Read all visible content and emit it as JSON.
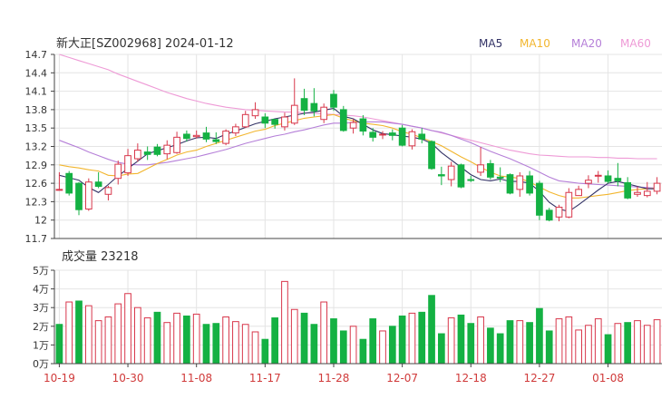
{
  "title": "新大正[SZ002968] 2024-01-12",
  "legend": [
    {
      "label": "MA5",
      "color": "#333366"
    },
    {
      "label": "MA10",
      "color": "#f2b62f"
    },
    {
      "label": "MA20",
      "color": "#b57fd8"
    },
    {
      "label": "MA60",
      "color": "#ee9ad6"
    }
  ],
  "colors": {
    "up": "#d8374b",
    "down": "#14b143",
    "xtick": "#d03a3a",
    "grid": "#e4e4e4",
    "axis": "#444444"
  },
  "volume_label": "成交量 23218",
  "chart_data": [
    {
      "type": "candlestick",
      "title": "新大正[SZ002968] 2024-01-12",
      "ylim": [
        11.7,
        14.7
      ],
      "yticks": [
        "14.7",
        "14.4",
        "14.1",
        "13.8",
        "13.5",
        "13.2",
        "12.9",
        "12.6",
        "12.3",
        "12",
        "11.7"
      ],
      "ytick_values": [
        14.7,
        14.4,
        14.1,
        13.8,
        13.5,
        13.2,
        12.9,
        12.6,
        12.3,
        12.0,
        11.7
      ],
      "xticks": [
        {
          "label": "10-19",
          "index": 0
        },
        {
          "label": "10-30",
          "index": 7
        },
        {
          "label": "11-08",
          "index": 14
        },
        {
          "label": "11-17",
          "index": 21
        },
        {
          "label": "11-28",
          "index": 28
        },
        {
          "label": "12-07",
          "index": 35
        },
        {
          "label": "12-18",
          "index": 42
        },
        {
          "label": "12-27",
          "index": 49
        },
        {
          "label": "01-08",
          "index": 56
        }
      ],
      "candles": [
        [
          12.5,
          12.5,
          12.78,
          12.48
        ],
        [
          12.76,
          12.44,
          12.8,
          12.4
        ],
        [
          12.6,
          12.17,
          12.62,
          12.08
        ],
        [
          12.18,
          12.62,
          12.68,
          12.15
        ],
        [
          12.62,
          12.55,
          12.78,
          12.52
        ],
        [
          12.42,
          12.53,
          12.56,
          12.32
        ],
        [
          12.68,
          12.91,
          12.97,
          12.58
        ],
        [
          12.77,
          13.05,
          13.16,
          12.72
        ],
        [
          13.0,
          13.14,
          13.25,
          12.95
        ],
        [
          13.11,
          13.07,
          13.2,
          12.98
        ],
        [
          13.19,
          13.07,
          13.24,
          13.04
        ],
        [
          13.08,
          13.22,
          13.3,
          12.99
        ],
        [
          13.1,
          13.35,
          13.44,
          13.08
        ],
        [
          13.4,
          13.33,
          13.46,
          13.28
        ],
        [
          13.36,
          13.38,
          13.46,
          13.33
        ],
        [
          13.42,
          13.32,
          13.52,
          13.27
        ],
        [
          13.31,
          13.28,
          13.43,
          13.24
        ],
        [
          13.25,
          13.45,
          13.48,
          13.22
        ],
        [
          13.42,
          13.52,
          13.57,
          13.37
        ],
        [
          13.52,
          13.72,
          13.78,
          13.5
        ],
        [
          13.7,
          13.8,
          13.92,
          13.65
        ],
        [
          13.68,
          13.58,
          13.74,
          13.5
        ],
        [
          13.64,
          13.56,
          13.64,
          13.49
        ],
        [
          13.52,
          13.68,
          13.75,
          13.46
        ],
        [
          13.58,
          13.87,
          14.31,
          13.55
        ],
        [
          13.98,
          13.79,
          14.14,
          13.71
        ],
        [
          13.9,
          13.78,
          14.15,
          13.69
        ],
        [
          13.64,
          13.84,
          13.9,
          13.58
        ],
        [
          14.05,
          13.84,
          14.12,
          13.78
        ],
        [
          13.8,
          13.46,
          13.86,
          13.44
        ],
        [
          13.5,
          13.59,
          13.65,
          13.41
        ],
        [
          13.65,
          13.45,
          13.71,
          13.38
        ],
        [
          13.43,
          13.35,
          13.5,
          13.28
        ],
        [
          13.4,
          13.4,
          13.45,
          13.32
        ],
        [
          13.42,
          13.38,
          13.48,
          13.3
        ],
        [
          13.5,
          13.22,
          13.55,
          13.2
        ],
        [
          13.21,
          13.44,
          13.48,
          13.15
        ],
        [
          13.4,
          13.32,
          13.5,
          13.25
        ],
        [
          13.28,
          12.84,
          13.3,
          12.82
        ],
        [
          12.74,
          12.72,
          12.87,
          12.57
        ],
        [
          12.66,
          12.88,
          12.95,
          12.55
        ],
        [
          12.9,
          12.54,
          12.92,
          12.52
        ],
        [
          12.66,
          12.65,
          12.72,
          12.62
        ],
        [
          12.78,
          12.9,
          13.19,
          12.72
        ],
        [
          12.92,
          12.7,
          12.98,
          12.66
        ],
        [
          12.7,
          12.69,
          12.86,
          12.62
        ],
        [
          12.74,
          12.44,
          12.76,
          12.42
        ],
        [
          12.5,
          12.72,
          12.78,
          12.38
        ],
        [
          12.72,
          12.44,
          12.8,
          12.4
        ],
        [
          12.6,
          12.08,
          12.64,
          12.0
        ],
        [
          12.16,
          12.0,
          12.2,
          11.98
        ],
        [
          12.05,
          12.21,
          12.25,
          11.98
        ],
        [
          12.05,
          12.45,
          12.52,
          12.03
        ],
        [
          12.4,
          12.5,
          12.56,
          12.4
        ],
        [
          12.6,
          12.65,
          12.73,
          12.52
        ],
        [
          12.72,
          12.73,
          12.8,
          12.61
        ],
        [
          12.72,
          12.63,
          12.81,
          12.6
        ],
        [
          12.68,
          12.64,
          12.93,
          12.55
        ],
        [
          12.61,
          12.36,
          12.7,
          12.34
        ],
        [
          12.42,
          12.45,
          12.55,
          12.38
        ],
        [
          12.4,
          12.47,
          12.62,
          12.37
        ],
        [
          12.47,
          12.6,
          12.7,
          12.42
        ]
      ],
      "ma5": [
        12.73,
        12.69,
        12.65,
        12.53,
        12.45,
        12.58,
        12.72,
        12.84,
        12.96,
        13.08,
        13.13,
        13.18,
        13.23,
        13.29,
        13.34,
        13.35,
        13.33,
        13.4,
        13.45,
        13.51,
        13.57,
        13.61,
        13.65,
        13.68,
        13.71,
        13.74,
        13.76,
        13.79,
        13.82,
        13.69,
        13.65,
        13.56,
        13.47,
        13.41,
        13.39,
        13.37,
        13.35,
        13.32,
        13.25,
        13.1,
        12.98,
        12.86,
        12.74,
        12.66,
        12.64,
        12.67,
        12.63,
        12.63,
        12.6,
        12.47,
        12.29,
        12.18,
        12.14,
        12.25,
        12.37,
        12.49,
        12.6,
        12.63,
        12.59,
        12.55,
        12.51,
        12.51
      ],
      "ma10": [
        12.9,
        12.87,
        12.85,
        12.82,
        12.8,
        12.73,
        12.72,
        12.75,
        12.76,
        12.84,
        12.92,
        12.99,
        13.06,
        13.11,
        13.14,
        13.2,
        13.25,
        13.3,
        13.35,
        13.4,
        13.45,
        13.48,
        13.54,
        13.58,
        13.62,
        13.66,
        13.68,
        13.7,
        13.72,
        13.66,
        13.62,
        13.58,
        13.56,
        13.54,
        13.5,
        13.44,
        13.4,
        13.34,
        13.28,
        13.21,
        13.12,
        13.03,
        12.95,
        12.86,
        12.78,
        12.72,
        12.7,
        12.68,
        12.62,
        12.54,
        12.46,
        12.4,
        12.36,
        12.36,
        12.38,
        12.4,
        12.42,
        12.45,
        12.48,
        12.5,
        12.51,
        12.52
      ],
      "ma20": [
        13.3,
        13.24,
        13.18,
        13.11,
        13.05,
        12.99,
        12.94,
        12.91,
        12.9,
        12.9,
        12.92,
        12.94,
        12.97,
        13.0,
        13.03,
        13.07,
        13.11,
        13.15,
        13.2,
        13.25,
        13.29,
        13.33,
        13.37,
        13.4,
        13.44,
        13.47,
        13.51,
        13.55,
        13.58,
        13.58,
        13.59,
        13.6,
        13.6,
        13.6,
        13.58,
        13.56,
        13.53,
        13.5,
        13.46,
        13.43,
        13.38,
        13.32,
        13.26,
        13.19,
        13.12,
        13.06,
        13.0,
        12.93,
        12.86,
        12.78,
        12.7,
        12.64,
        12.62,
        12.6,
        12.59,
        12.58,
        12.57,
        12.56,
        12.55,
        12.54,
        12.53,
        12.52
      ],
      "ma60": [
        14.7,
        14.65,
        14.6,
        14.55,
        14.5,
        14.45,
        14.38,
        14.32,
        14.26,
        14.2,
        14.14,
        14.08,
        14.03,
        13.98,
        13.94,
        13.9,
        13.87,
        13.84,
        13.82,
        13.8,
        13.79,
        13.78,
        13.77,
        13.76,
        13.76,
        13.75,
        13.74,
        13.73,
        13.72,
        13.71,
        13.7,
        13.68,
        13.65,
        13.62,
        13.59,
        13.56,
        13.53,
        13.5,
        13.46,
        13.42,
        13.38,
        13.34,
        13.3,
        13.26,
        13.22,
        13.18,
        13.14,
        13.11,
        13.08,
        13.06,
        13.05,
        13.04,
        13.03,
        13.03,
        13.03,
        13.02,
        13.02,
        13.01,
        13.01,
        13.0,
        13.0,
        13.0
      ]
    },
    {
      "type": "bar",
      "title": "成交量 23218",
      "ylim": [
        0,
        5
      ],
      "yticks": [
        "5万",
        "4万",
        "3万",
        "2万",
        "1万",
        "0万"
      ],
      "ytick_values": [
        5,
        4,
        3,
        2,
        1,
        0
      ],
      "values": [
        2.1,
        3.3,
        3.35,
        3.1,
        2.3,
        2.5,
        3.2,
        3.75,
        3.0,
        2.45,
        2.75,
        2.2,
        2.7,
        2.55,
        2.65,
        2.1,
        2.15,
        2.5,
        2.25,
        2.1,
        1.7,
        1.3,
        2.45,
        4.4,
        2.9,
        2.7,
        2.1,
        3.3,
        2.4,
        1.75,
        2.0,
        1.3,
        2.4,
        1.75,
        2.0,
        2.55,
        2.7,
        2.75,
        3.65,
        1.6,
        2.45,
        2.6,
        2.15,
        2.5,
        1.9,
        1.6,
        2.3,
        2.3,
        2.2,
        2.95,
        1.75,
        2.4,
        2.5,
        1.8,
        2.05,
        2.4,
        1.55,
        2.15,
        2.2,
        2.3,
        2.05,
        2.35
      ],
      "up": [
        false,
        true,
        false,
        true,
        true,
        true,
        true,
        true,
        true,
        true,
        false,
        true,
        true,
        false,
        true,
        false,
        false,
        true,
        true,
        true,
        true,
        false,
        false,
        true,
        true,
        false,
        false,
        true,
        false,
        false,
        true,
        false,
        false,
        true,
        false,
        false,
        true,
        false,
        false,
        false,
        true,
        false,
        false,
        true,
        false,
        false,
        false,
        true,
        false,
        false,
        false,
        true,
        true,
        true,
        true,
        true,
        false,
        true,
        false,
        true,
        true,
        true
      ]
    }
  ]
}
